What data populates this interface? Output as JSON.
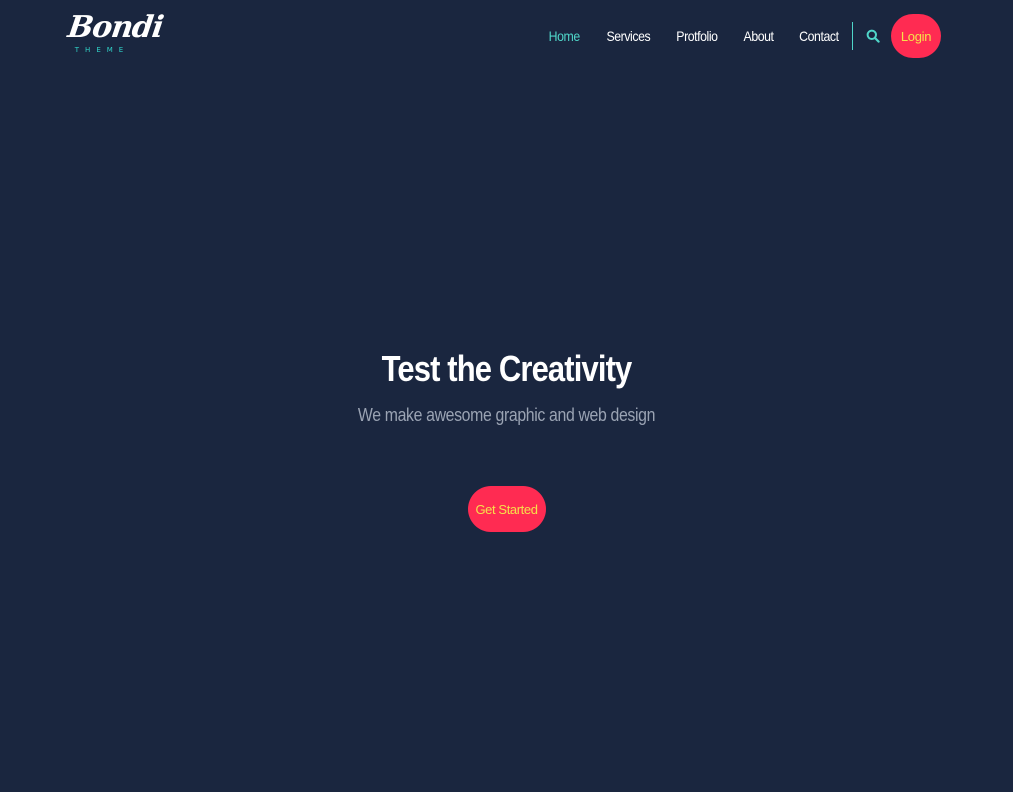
{
  "brand": {
    "logo_main": "Bondi",
    "logo_sub": "THEME"
  },
  "nav": {
    "items": [
      {
        "label": "Home",
        "active": true
      },
      {
        "label": "Services",
        "active": false
      },
      {
        "label": "Protfolio",
        "active": false
      },
      {
        "label": "About",
        "active": false
      },
      {
        "label": "Contact",
        "active": false
      }
    ],
    "search_icon": "search-icon",
    "login_label": "Login"
  },
  "hero": {
    "title": "Test the Creativity",
    "subtitle": "We make awesome graphic and web design",
    "cta_label": "Get Started"
  },
  "colors": {
    "background": "#1a263f",
    "accent": "#4fd6c9",
    "button": "#ff2b52",
    "button_text": "#f6e04a"
  }
}
